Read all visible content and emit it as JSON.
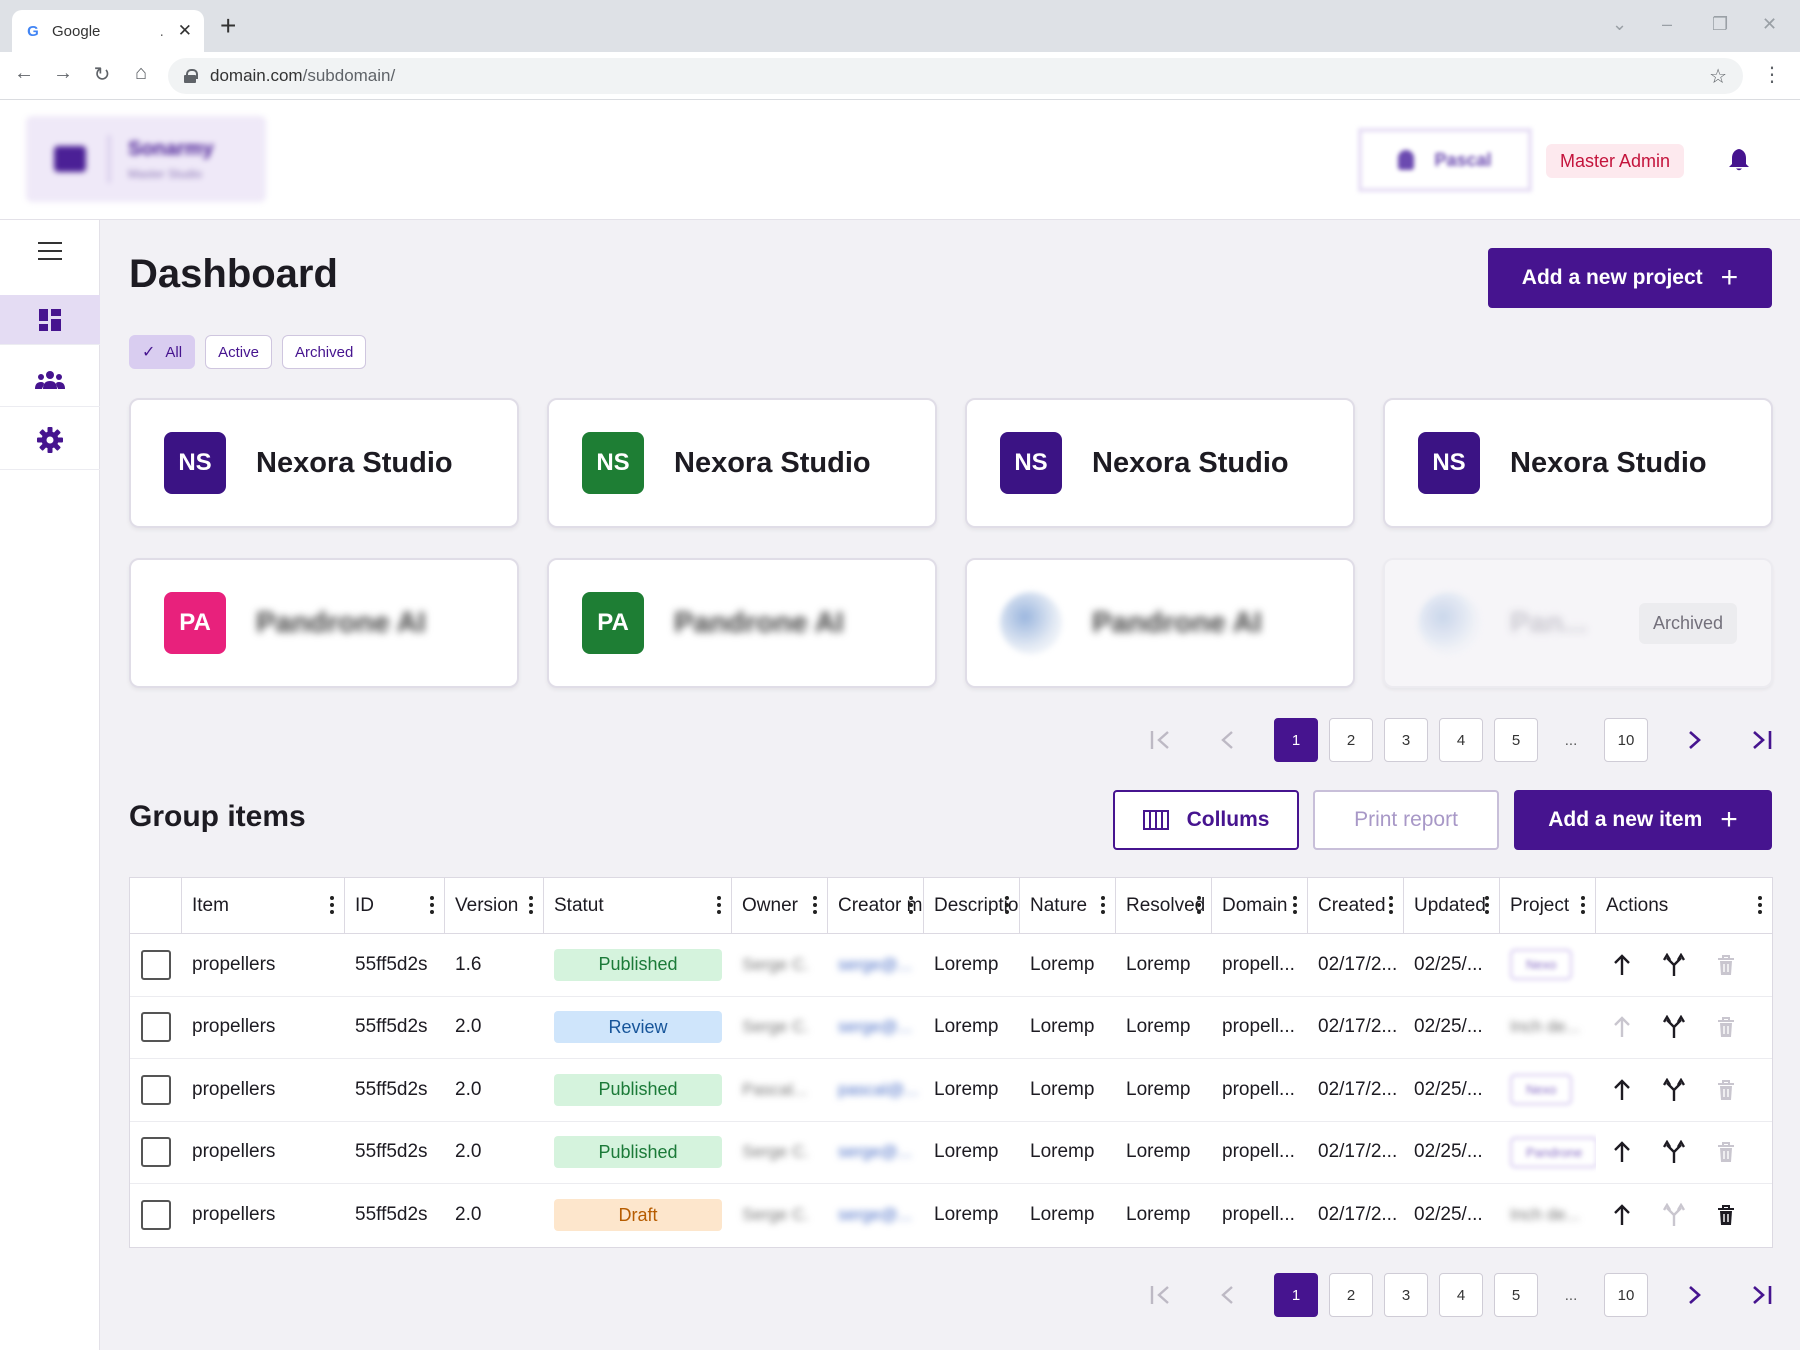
{
  "browser": {
    "tab_title": "Google",
    "tab_dot": ".",
    "tab_close": "✕",
    "new_tab": "+",
    "url_host": "domain.com",
    "url_path": "/subdomain/"
  },
  "header": {
    "brand_name": "Sonarmy",
    "brand_sub": "Master Studio",
    "user_name": "Pascal",
    "role": "Master Admin"
  },
  "page": {
    "title": "Dashboard",
    "add_project_label": "Add a new project",
    "filters": [
      {
        "label": "All",
        "selected": true
      },
      {
        "label": "Active",
        "selected": false
      },
      {
        "label": "Archived",
        "selected": false
      }
    ]
  },
  "projects": [
    {
      "initials": "NS",
      "name": "Nexora Studio",
      "color": "#3b1384"
    },
    {
      "initials": "NS",
      "name": "Nexora Studio",
      "color": "#1e7e34"
    },
    {
      "initials": "NS",
      "name": "Nexora Studio",
      "color": "#3b1384"
    },
    {
      "initials": "NS",
      "name": "Nexora Studio",
      "color": "#3b1384"
    },
    {
      "initials": "PA",
      "name": "Pandrone AI",
      "color": "#e8217c"
    },
    {
      "initials": "PA",
      "name": "Pandrone AI",
      "color": "#1e7e34"
    },
    {
      "initials": "",
      "name": "Pandrone AI",
      "color": ""
    },
    {
      "initials": "",
      "name": "Pan...",
      "color": "",
      "badge": "Archived"
    }
  ],
  "pager": {
    "pages": [
      "1",
      "2",
      "3",
      "4",
      "5"
    ],
    "ellipsis": "...",
    "last": "10",
    "current": "1"
  },
  "group": {
    "title": "Group items",
    "columns_label": "Collums",
    "print_label": "Print report",
    "add_item_label": "Add a new item"
  },
  "table": {
    "headers": [
      "",
      "Item",
      "ID",
      "Version",
      "Statut",
      "Owner",
      "Creator mail",
      "Description",
      "Nature",
      "Resolved in",
      "Domain",
      "Created",
      "Updated",
      "Project",
      "Actions"
    ],
    "rows": [
      {
        "item": "propellers",
        "id": "55ff5d2s",
        "version": "1.6",
        "status": "Published",
        "status_kind": "pub",
        "owner": "Serge C.",
        "mail": "serge@...",
        "desc": "Loremp",
        "nature": "Loremp",
        "resolved": "Loremp",
        "domain": "propell...",
        "created": "02/17/2...",
        "updated": "02/25/...",
        "project": "Nexo",
        "project_kind": "pill",
        "up": true,
        "merge": true,
        "del": false
      },
      {
        "item": "propellers",
        "id": "55ff5d2s",
        "version": "2.0",
        "status": "Review",
        "status_kind": "rev",
        "owner": "Serge C.",
        "mail": "serge@...",
        "desc": "Loremp",
        "nature": "Loremp",
        "resolved": "Loremp",
        "domain": "propell...",
        "created": "02/17/2...",
        "updated": "02/25/...",
        "project": "Inch de...",
        "project_kind": "text",
        "up": false,
        "merge": true,
        "del": false
      },
      {
        "item": "propellers",
        "id": "55ff5d2s",
        "version": "2.0",
        "status": "Published",
        "status_kind": "pub",
        "owner": "Pascal...",
        "mail": "pascal@...",
        "desc": "Loremp",
        "nature": "Loremp",
        "resolved": "Loremp",
        "domain": "propell...",
        "created": "02/17/2...",
        "updated": "02/25/...",
        "project": "Nexo",
        "project_kind": "pill",
        "up": true,
        "merge": true,
        "del": false
      },
      {
        "item": "propellers",
        "id": "55ff5d2s",
        "version": "2.0",
        "status": "Published",
        "status_kind": "pub",
        "owner": "Serge C.",
        "mail": "serge@...",
        "desc": "Loremp",
        "nature": "Loremp",
        "resolved": "Loremp",
        "domain": "propell...",
        "created": "02/17/2...",
        "updated": "02/25/...",
        "project": "Pandrone",
        "project_kind": "pill",
        "up": true,
        "merge": true,
        "del": false
      },
      {
        "item": "propellers",
        "id": "55ff5d2s",
        "version": "2.0",
        "status": "Draft",
        "status_kind": "dra",
        "owner": "Serge C.",
        "mail": "serge@...",
        "desc": "Loremp",
        "nature": "Loremp",
        "resolved": "Loremp",
        "domain": "propell...",
        "created": "02/17/2...",
        "updated": "02/25/...",
        "project": "Inch de...",
        "project_kind": "text",
        "up": true,
        "merge": false,
        "del": true
      }
    ]
  },
  "colors": {
    "primary": "#46148f",
    "active_icon": "#1d1b22",
    "disabled_icon": "#c9c6cf"
  },
  "icons": {
    "sidebar": [
      "menu-icon",
      "dashboard-icon",
      "users-icon",
      "settings-icon"
    ],
    "actions": [
      "arrow-up-icon",
      "merge-icon",
      "trash-icon"
    ]
  }
}
